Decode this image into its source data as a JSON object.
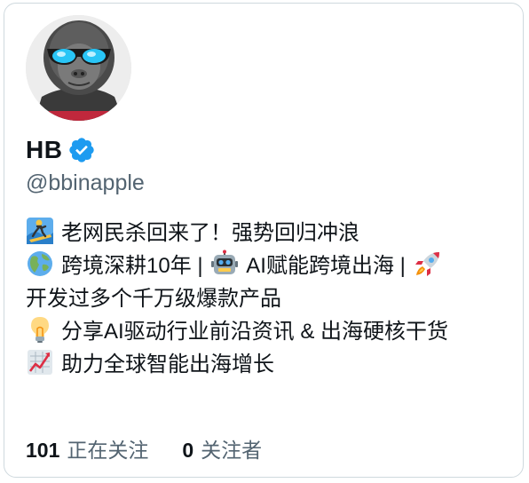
{
  "profile": {
    "display_name": "HB",
    "handle": "@bbinapple",
    "verified": true,
    "verified_color": "#1d9bf0"
  },
  "bio": {
    "line1": {
      "icon": "surfer-emoji",
      "text": "老网民杀回来了！强势回归冲浪"
    },
    "line2": {
      "icon": "globe-emoji",
      "text": "跨境深耕10年 |",
      "icon2": "robot-emoji",
      "text2": "AI赋能跨境出海 |",
      "icon3": "rocket-emoji"
    },
    "line3": {
      "text": "开发过多个千万级爆款产品"
    },
    "line4": {
      "icon": "lightbulb-emoji",
      "text": "分享AI驱动行业前沿资讯 & 出海硬核干货"
    },
    "line5": {
      "icon": "chart-increasing-emoji",
      "text": "助力全球智能出海增长"
    }
  },
  "stats": {
    "following_count": "101",
    "following_label": "正在关注",
    "followers_count": "0",
    "followers_label": "关注者"
  },
  "colors": {
    "text": "#0f1419",
    "secondary": "#536471",
    "border": "#cfd9de"
  }
}
